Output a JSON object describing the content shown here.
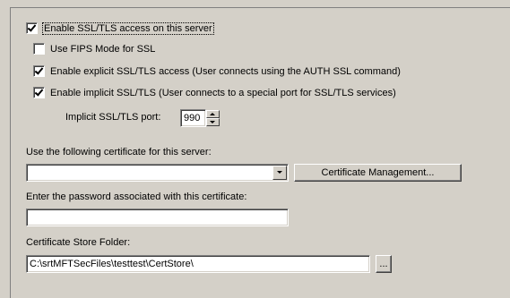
{
  "ssl": {
    "enable_label": "Enable SSL/TLS access on this server",
    "enable_checked": true,
    "fips_label": "Use FIPS Mode for SSL",
    "fips_checked": false,
    "explicit_label": "Enable explicit SSL/TLS access (User connects using the AUTH SSL command)",
    "explicit_checked": true,
    "implicit_label": "Enable implicit SSL/TLS (User connects to a special port for SSL/TLS services)",
    "implicit_checked": true,
    "port_label": "Implicit SSL/TLS port:",
    "port_value": "990"
  },
  "certificate": {
    "label": "Use the following certificate for this server:",
    "selected": "",
    "manage_button": "Certificate Management...",
    "password_label": "Enter the password associated with this certificate:",
    "password_value": "",
    "store_label": "Certificate Store Folder:",
    "store_value": "C:\\srtMFTSecFiles\\testtest\\CertStore\\",
    "browse_button": "..."
  }
}
